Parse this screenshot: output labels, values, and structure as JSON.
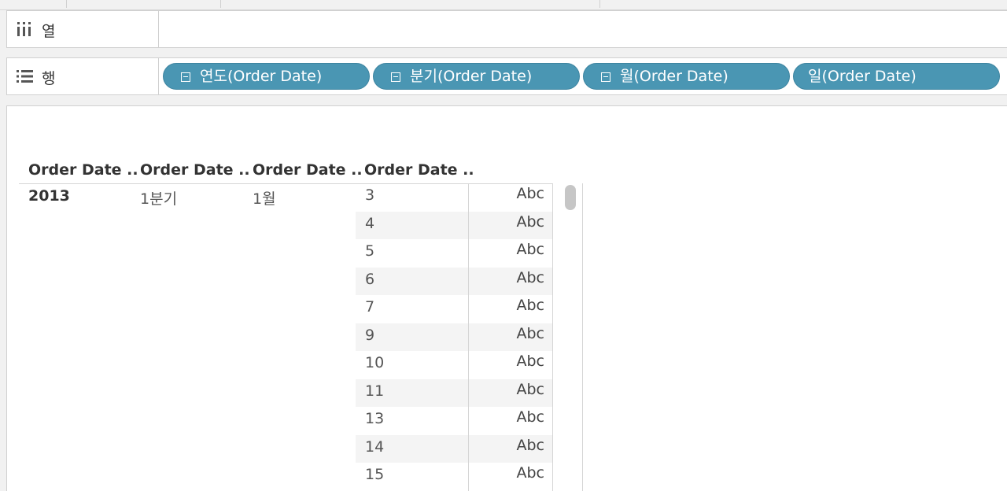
{
  "shelves": {
    "columns": {
      "label": "열",
      "icon": "columns-icon"
    },
    "rows": {
      "label": "행",
      "icon": "rows-icon",
      "pills": [
        {
          "label": "연도(Order Date)",
          "collapse": true
        },
        {
          "label": "분기(Order Date)",
          "collapse": true
        },
        {
          "label": "월(Order Date)",
          "collapse": true
        },
        {
          "label": "일(Order Date)",
          "collapse": false
        }
      ]
    }
  },
  "view": {
    "column_headers": [
      "Order Date ..",
      "Order Date ..",
      "Order Date ..",
      "Order Date .."
    ],
    "year": "2013",
    "quarter": "1분기",
    "month": "1월",
    "rows": [
      {
        "day": "3",
        "value": "Abc"
      },
      {
        "day": "4",
        "value": "Abc"
      },
      {
        "day": "5",
        "value": "Abc"
      },
      {
        "day": "6",
        "value": "Abc"
      },
      {
        "day": "7",
        "value": "Abc"
      },
      {
        "day": "9",
        "value": "Abc"
      },
      {
        "day": "10",
        "value": "Abc"
      },
      {
        "day": "11",
        "value": "Abc"
      },
      {
        "day": "13",
        "value": "Abc"
      },
      {
        "day": "14",
        "value": "Abc"
      },
      {
        "day": "15",
        "value": "Abc"
      }
    ]
  },
  "colors": {
    "pill": "#4a96b3",
    "pill_text": "#ffffff",
    "band": "#f4f4f4"
  }
}
